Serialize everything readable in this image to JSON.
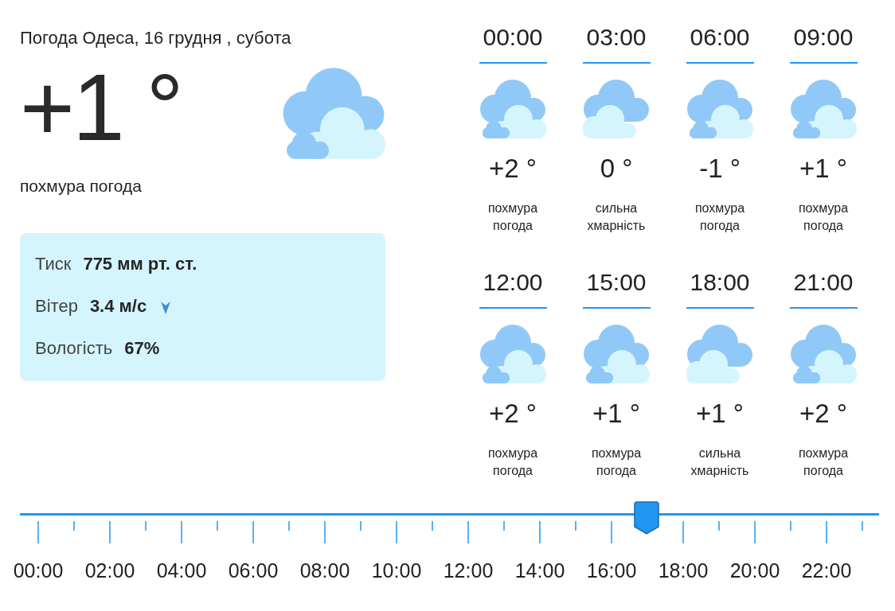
{
  "header": {
    "title": "Погода Одеса, 16 грудня , субота"
  },
  "current": {
    "temperature": "+1 °",
    "kind": "overcast",
    "description": "похмура погода",
    "details": [
      {
        "kind": "pressure",
        "label": "Тиск",
        "value": "775 мм рт. ст."
      },
      {
        "kind": "wind",
        "label": "Вітер",
        "value": "3.4 м/с"
      },
      {
        "kind": "humidity",
        "label": "Вологість",
        "value": "67%"
      }
    ]
  },
  "forecast": [
    {
      "time": "00:00",
      "kind": "overcast",
      "temperature": "+2 °",
      "description": "похмура погода"
    },
    {
      "time": "03:00",
      "kind": "heavy",
      "temperature": "0 °",
      "description": "сильна хмарність"
    },
    {
      "time": "06:00",
      "kind": "overcast",
      "temperature": "-1 °",
      "description": "похмура погода"
    },
    {
      "time": "09:00",
      "kind": "overcast",
      "temperature": "+1 °",
      "description": "похмура погода"
    },
    {
      "time": "12:00",
      "kind": "overcast",
      "temperature": "+2 °",
      "description": "похмура погода"
    },
    {
      "time": "15:00",
      "kind": "overcast",
      "temperature": "+1 °",
      "description": "похмура погода"
    },
    {
      "time": "18:00",
      "kind": "heavy",
      "temperature": "+1 °",
      "description": "сильна хмарність"
    },
    {
      "time": "21:00",
      "kind": "overcast",
      "temperature": "+2 °",
      "description": "похмура погода"
    }
  ],
  "timeline": {
    "level": 0.729,
    "labels": [
      "00:00",
      "02:00",
      "04:00",
      "06:00",
      "08:00",
      "10:00",
      "12:00",
      "14:00",
      "16:00",
      "18:00",
      "20:00",
      "22:00"
    ]
  }
}
